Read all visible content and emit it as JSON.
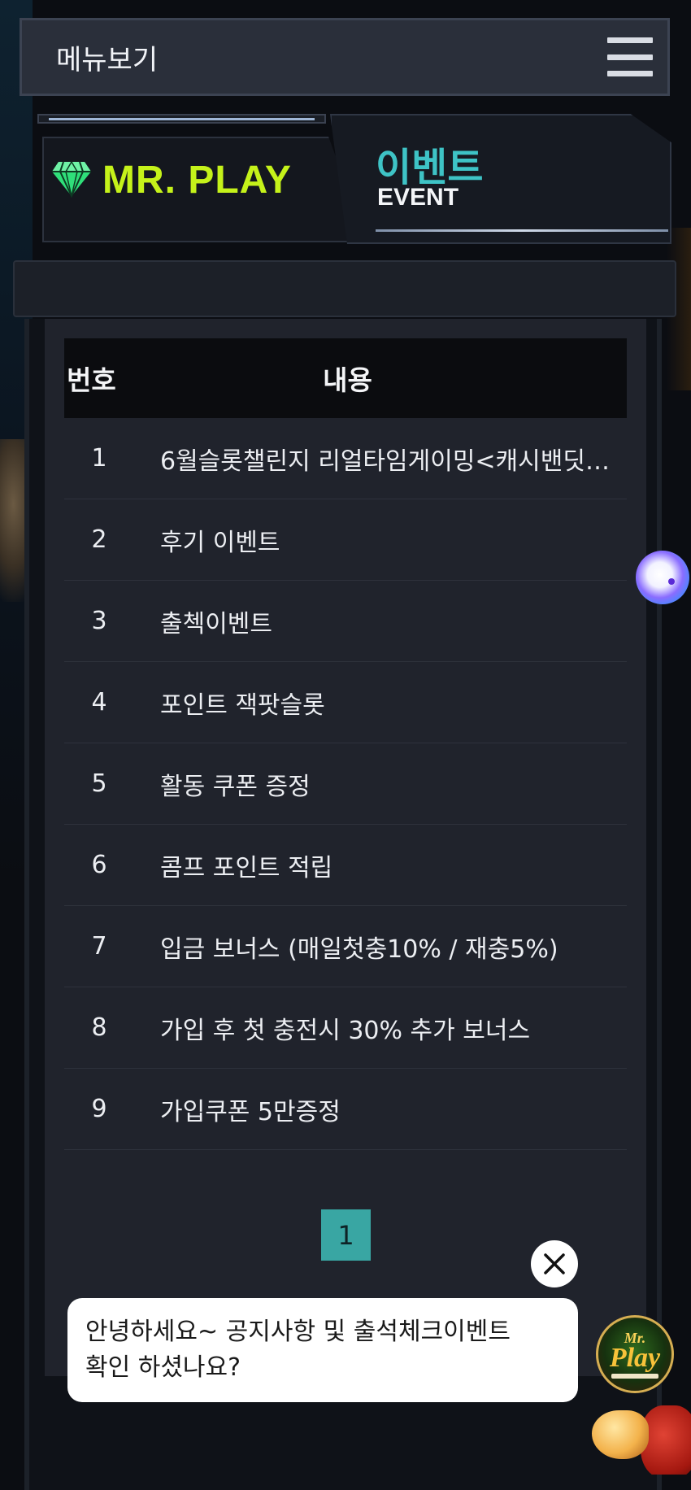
{
  "menu": {
    "label": "메뉴보기",
    "icon": "hamburger-icon"
  },
  "banner": {
    "brand": "MR. PLAY",
    "brand_icon": "diamond-icon",
    "title_ko": "이벤트",
    "title_en": "EVENT"
  },
  "table": {
    "columns": {
      "number": "번호",
      "content": "내용"
    },
    "rows": [
      {
        "no": "1",
        "title": "6월슬롯챌린지 리얼타임게이밍<캐시밴딧…"
      },
      {
        "no": "2",
        "title": "후기 이벤트"
      },
      {
        "no": "3",
        "title": "출첵이벤트"
      },
      {
        "no": "4",
        "title": "포인트 잭팟슬롯"
      },
      {
        "no": "5",
        "title": "활동 쿠폰 증정"
      },
      {
        "no": "6",
        "title": "콤프 포인트 적립"
      },
      {
        "no": "7",
        "title": "입금 보너스 (매일첫충10% / 재충5%)"
      },
      {
        "no": "8",
        "title": "가입 후 첫 충전시 30% 추가 보너스"
      },
      {
        "no": "9",
        "title": "가입쿠폰 5만증정"
      }
    ]
  },
  "pagination": {
    "current": "1"
  },
  "chat": {
    "message_line1": "안녕하세요~ 공지사항 및 출석체크이벤트",
    "message_line2": "확인 하셨나요?",
    "avatar_logo_top": "Mr.",
    "avatar_logo_main": "Play"
  },
  "colors": {
    "accent_teal": "#39a6a3",
    "brand_lime": "#c5f21a",
    "event_teal": "#3ec3c6",
    "panel_bg": "#20232c"
  }
}
